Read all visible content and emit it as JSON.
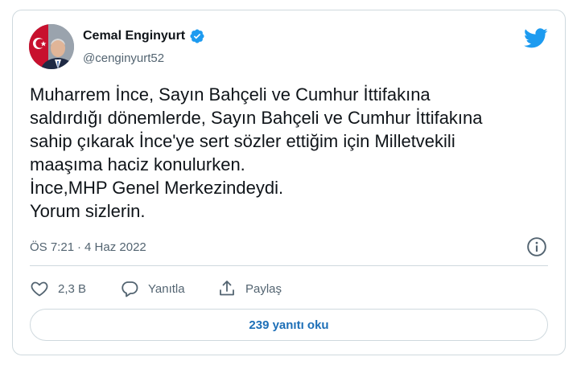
{
  "author": {
    "name": "Cemal Enginyurt",
    "handle": "@cenginyurt52",
    "verified": true
  },
  "tweet": {
    "lines": [
      "Muharrem İnce, Sayın Bahçeli ve Cumhur İttifakına",
      "saldırdığı dönemlerde, Sayın Bahçeli ve Cumhur İttifakına",
      "sahip çıkarak İnce'ye sert sözler ettiğim için Milletvekili",
      "maaşıma haciz konulurken.",
      "İnce,MHP Genel Merkezindeydi.",
      "Yorum sizlerin."
    ],
    "time": "ÖS 7:21",
    "separator": "·",
    "date": "4 Haz 2022"
  },
  "actions": {
    "like_count": "2,3 B",
    "reply_label": "Yanıtla",
    "share_label": "Paylaş"
  },
  "replies_button": "239 yanıtı oku",
  "icons": {
    "logo": "twitter-bird-icon",
    "verified": "verified-badge-icon",
    "info": "info-icon",
    "like": "heart-icon",
    "reply": "speech-bubble-icon",
    "share": "share-upload-icon"
  },
  "colors": {
    "brand": "#1d9bf0",
    "text": "#0f1419",
    "muted": "#536471",
    "border": "#cfd9de",
    "link": "#1d6fb7"
  }
}
